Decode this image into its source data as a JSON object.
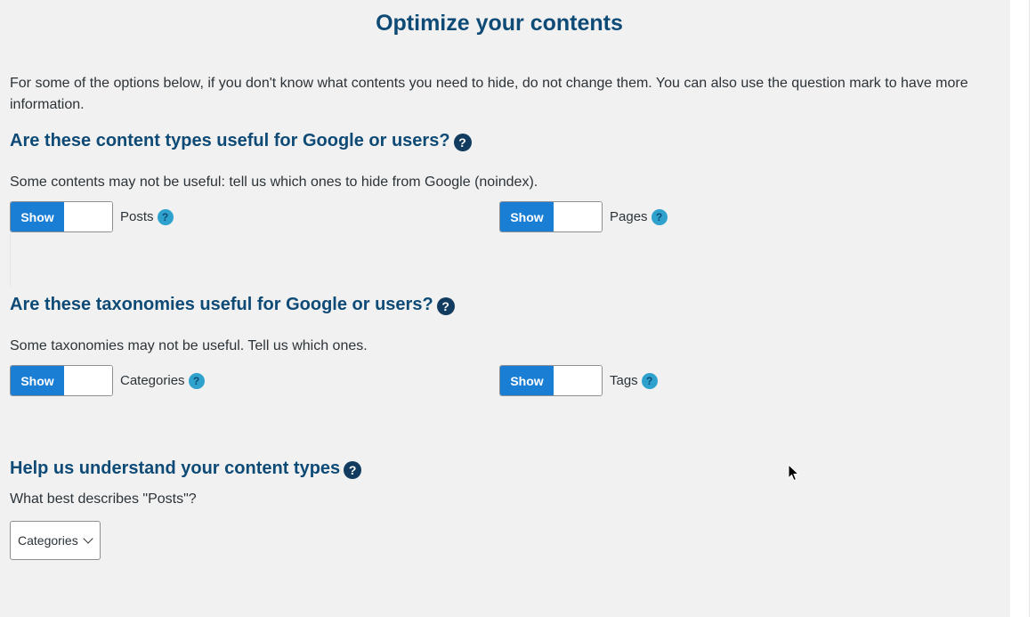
{
  "page": {
    "title": "Optimize your contents",
    "intro": "For some of the options below, if you don't know what contents you need to hide, do not change them. You can also use the question mark to have more information."
  },
  "content_types": {
    "heading": "Are these content types useful for Google or users?",
    "help_symbol": "?",
    "description": "Some contents may not be useful: tell us which ones to hide from Google (noindex).",
    "items": [
      {
        "toggle_label": "Show",
        "label": "Posts",
        "help_symbol": "?"
      },
      {
        "toggle_label": "Show",
        "label": "Pages",
        "help_symbol": "?"
      }
    ]
  },
  "taxonomies": {
    "heading": "Are these taxonomies useful for Google or users?",
    "help_symbol": "?",
    "description": "Some taxonomies may not be useful. Tell us which ones.",
    "items": [
      {
        "toggle_label": "Show",
        "label": "Categories",
        "help_symbol": "?"
      },
      {
        "toggle_label": "Show",
        "label": "Tags",
        "help_symbol": "?"
      }
    ]
  },
  "understand": {
    "heading": "Help us understand your content types",
    "help_symbol": "?",
    "question": "What best describes \"Posts\"?",
    "select_value": "Categories"
  },
  "colors": {
    "heading": "#0e4a76",
    "toggle_on": "#1a7fd4",
    "help_light": "#2ea2cc",
    "help_dark": "#123c5f"
  },
  "icons": {
    "help_dark": "question-circle-dark-icon",
    "help_light": "question-circle-light-icon",
    "dropdown": "chevron-down-icon",
    "cursor": "mouse-pointer-icon"
  }
}
